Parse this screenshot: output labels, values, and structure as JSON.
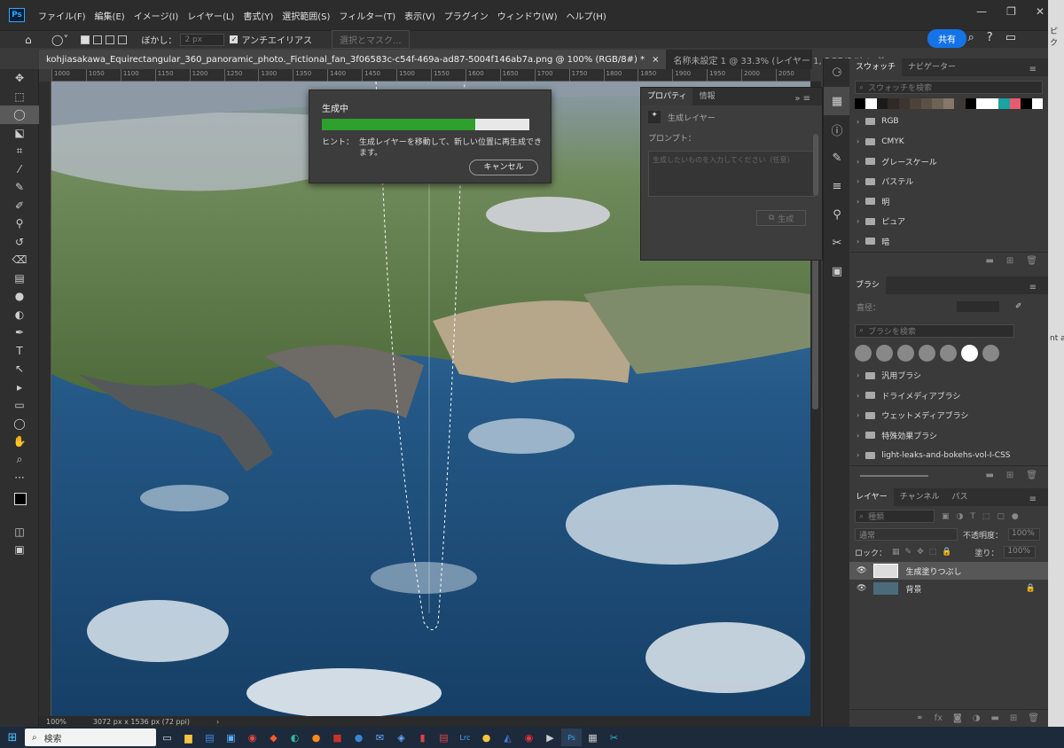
{
  "menubar": {
    "logo": "Ps",
    "items": [
      "ファイル(F)",
      "編集(E)",
      "イメージ(I)",
      "レイヤー(L)",
      "書式(Y)",
      "選択範囲(S)",
      "フィルター(T)",
      "表示(V)",
      "プラグイン",
      "ウィンドウ(W)",
      "ヘルプ(H)"
    ]
  },
  "options": {
    "feather_label": "ぼかし：",
    "feather_value": "2 px",
    "antialias_label": "アンチエイリアス",
    "select_mask": "選択とマスク...",
    "share": "共有"
  },
  "tabs": [
    {
      "label": "kohjiasakawa_Equirectangular_360_panoramic_photo._Fictional_fan_3f06583c-c54f-469a-ad87-5004f146ab7a.png @ 100% (RGB/8#) *",
      "close": "×"
    },
    {
      "label": "名称未設定 1 @ 33.3% (レイヤー 1, RGB/8#) *",
      "close": "×"
    }
  ],
  "ruler_ticks": [
    "1000",
    "1050",
    "1100",
    "1150",
    "1200",
    "1250",
    "1300",
    "1350",
    "1400",
    "1450",
    "1500",
    "1550",
    "1600",
    "1650",
    "1700",
    "1750",
    "1800",
    "1850",
    "1900",
    "1950",
    "2000",
    "2050"
  ],
  "progress": {
    "title": "生成中",
    "percent": 0.74,
    "hint_label": "ヒント：",
    "hint_text": "生成レイヤーを移動して、新しい位置に再生成できます。",
    "cancel": "キャンセル"
  },
  "properties": {
    "tabs": [
      "プロパティ",
      "情報"
    ],
    "layer_type": "生成レイヤー",
    "prompt_label": "プロンプト：",
    "prompt_placeholder": "生成したいものを入力してください（任意）",
    "generate": "生成"
  },
  "swatches": {
    "tabs": [
      "スウォッチ",
      "ナビゲーター"
    ],
    "search": "スウォッチを検索",
    "colors": [
      "#000000",
      "#ffffff",
      "#1a1a1a",
      "#2f2a26",
      "#3d3530",
      "#4c433a",
      "#5b5147",
      "#6e6355",
      "#85786a",
      "#3c3a36",
      "#000000",
      "#ffffff",
      "#ffffff",
      "#1aa3a0",
      "#e85a6e",
      "#000000",
      "#ffffff"
    ],
    "groups": [
      "RGB",
      "CMYK",
      "グレースケール",
      "パステル",
      "明",
      "ピュア",
      "暗"
    ]
  },
  "brushes": {
    "tab": "ブラシ",
    "size_label": "直径：",
    "search": "ブラシを検索",
    "groups": [
      "汎用ブラシ",
      "ドライメディアブラシ",
      "ウェットメディアブラシ",
      "特殊効果ブラシ",
      "light-leaks-and-bokehs-vol-I-CSS"
    ]
  },
  "layers": {
    "tabs": [
      "レイヤー",
      "チャンネル",
      "パス"
    ],
    "filter": "種類",
    "blend": "通常",
    "opacity_label": "不透明度：",
    "opacity": "100%",
    "lock_label": "ロック：",
    "fill_label": "塗り：",
    "fill": "100%",
    "items": [
      {
        "name": "生成塗りつぶし",
        "selected": true
      },
      {
        "name": "背景",
        "selected": false
      }
    ]
  },
  "status": {
    "zoom": "100%",
    "dims": "3072 px x 1536 px (72 ppi)"
  },
  "taskbar": {
    "search": "検索"
  },
  "edge_text": {
    "top": "ピク",
    "mid": "nt a"
  }
}
